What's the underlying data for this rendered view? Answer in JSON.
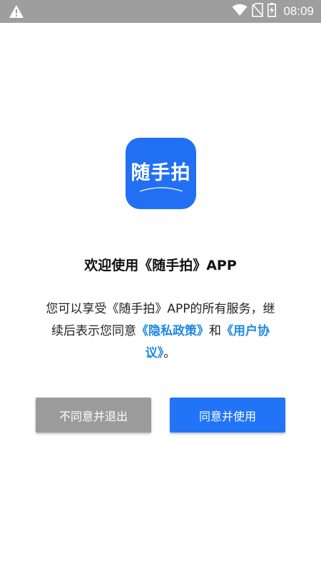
{
  "status_bar": {
    "time": "08:09",
    "icons": [
      "warning-icon",
      "wifi-icon",
      "no-sim-icon",
      "battery-charging-icon"
    ]
  },
  "app_icon": {
    "label": "随手拍",
    "background_color": "#2170f3"
  },
  "dialog": {
    "title": "欢迎使用《随手拍》APP",
    "desc_part1": "您可以享受《随手拍》APP的所有服务，继续后表示您同意",
    "privacy_link": "《隐私政策》",
    "desc_and": "和",
    "agreement_link": "《用户协议》",
    "desc_end": "。"
  },
  "buttons": {
    "disagree_label": "不同意并退出",
    "agree_label": "同意并使用"
  },
  "colors": {
    "status_bar": "#9e9e9e",
    "link": "#1e88e5",
    "agree_button": "#2174f5",
    "disagree_button": "#9b9b9b"
  }
}
